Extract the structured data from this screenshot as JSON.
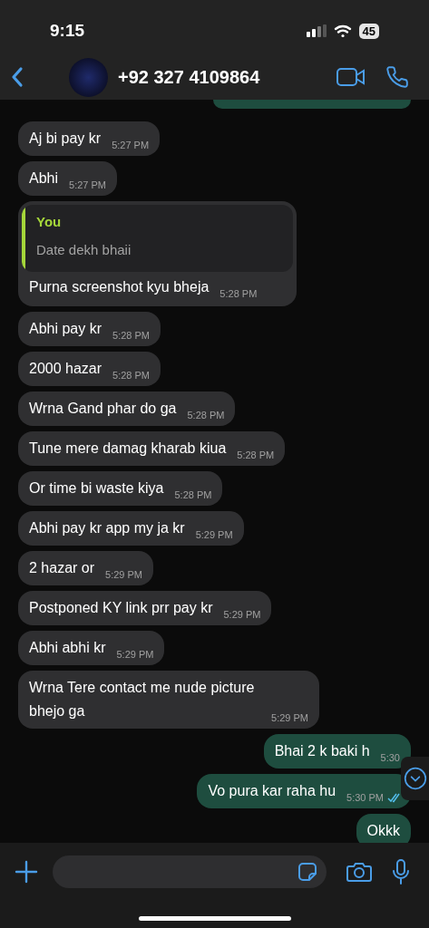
{
  "status_bar": {
    "time": "9:15",
    "battery": "45"
  },
  "header": {
    "contact": "+92 327 4109864"
  },
  "messages": [
    {
      "kind": "partial"
    },
    {
      "kind": "incoming",
      "text": "Aj bi pay kr",
      "time": "5:27 PM"
    },
    {
      "kind": "incoming",
      "text": "Abhi",
      "time": "5:27 PM"
    },
    {
      "kind": "incoming",
      "text": "Purna screenshot kyu bheja",
      "time": "5:28 PM",
      "reply": {
        "author": "You",
        "text": "Date dekh bhaii"
      }
    },
    {
      "kind": "incoming",
      "text": "Abhi pay kr",
      "time": "5:28 PM"
    },
    {
      "kind": "incoming",
      "text": "2000 hazar",
      "time": "5:28 PM"
    },
    {
      "kind": "incoming",
      "text": "Wrna Gand phar do ga",
      "time": "5:28 PM"
    },
    {
      "kind": "incoming",
      "text": "Tune mere damag kharab kiua",
      "time": "5:28 PM"
    },
    {
      "kind": "incoming",
      "text": "Or time bi waste kiya",
      "time": "5:28 PM"
    },
    {
      "kind": "incoming",
      "text": "Abhi pay kr app my ja kr",
      "time": "5:29 PM"
    },
    {
      "kind": "incoming",
      "text": "2 hazar or",
      "time": "5:29 PM"
    },
    {
      "kind": "incoming",
      "text": "Postponed KY link prr pay kr",
      "time": "5:29 PM"
    },
    {
      "kind": "incoming",
      "text": "Abhi abhi kr",
      "time": "5:29 PM"
    },
    {
      "kind": "incoming",
      "text": "Wrna Tere contact me nude picture bhejo ga",
      "time": "5:29 PM"
    },
    {
      "kind": "outgoing",
      "text": "Bhai 2 k baki h",
      "time": "5:30"
    },
    {
      "kind": "outgoing",
      "text": "Vo pura kar raha hu",
      "time": "5:30 PM",
      "read": true
    },
    {
      "kind": "outgoing",
      "text": "Okkk"
    }
  ]
}
